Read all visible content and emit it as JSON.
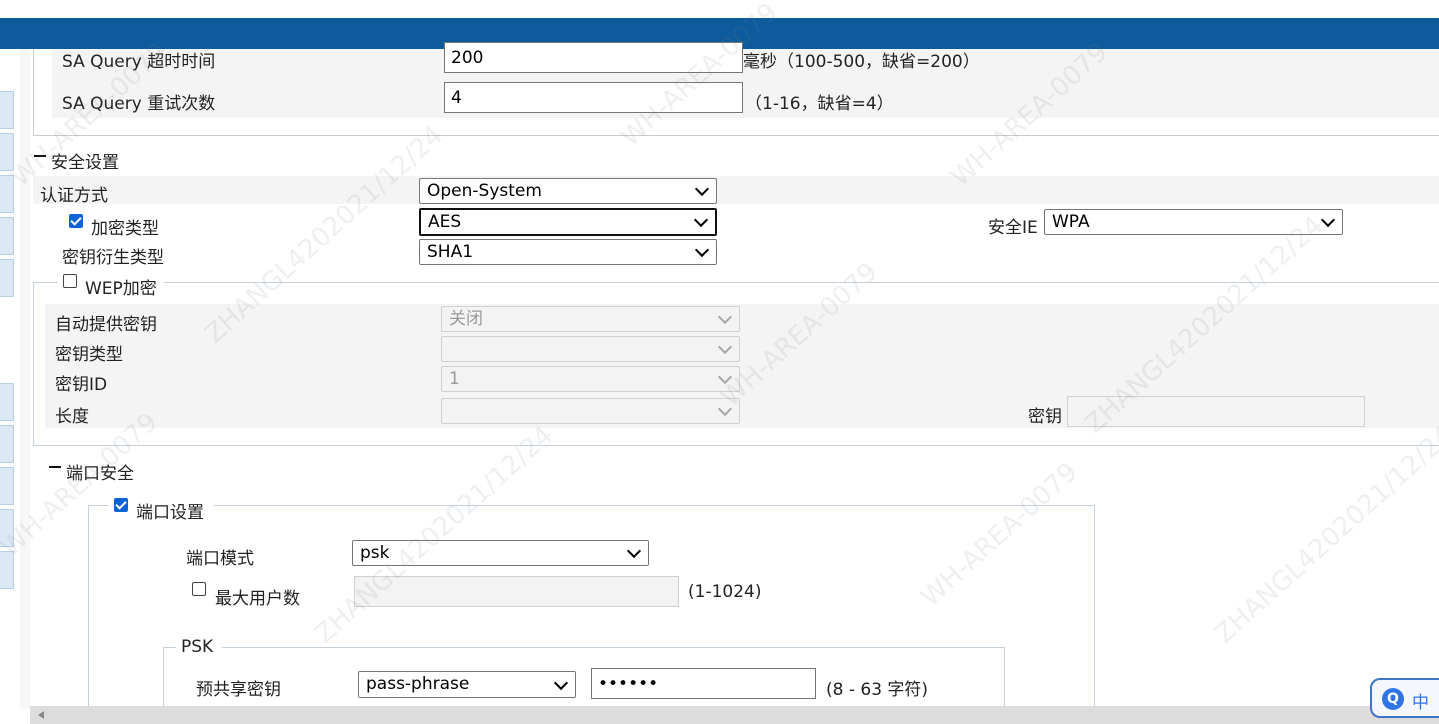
{
  "sa_query": {
    "timeout_label": "SA Query 超时时间",
    "timeout_value": "200",
    "timeout_hint": "毫秒（100-500，缺省=200）",
    "retry_label": "SA Query 重试次数",
    "retry_value": "4",
    "retry_hint": "（1-16，缺省=4）"
  },
  "security": {
    "section_title": "安全设置",
    "auth_label": "认证方式",
    "auth_value": "Open-System",
    "encrypt_label": "加密类型",
    "encrypt_checked": true,
    "encrypt_value": "AES",
    "security_ie_label": "安全IE",
    "security_ie_value": "WPA",
    "key_derivation_label": "密钥衍生类型",
    "key_derivation_value": "SHA1"
  },
  "wep": {
    "legend": "WEP加密",
    "checked": false,
    "auto_key_label": "自动提供密钥",
    "auto_key_value": "关闭",
    "key_type_label": "密钥类型",
    "key_type_value": "",
    "key_id_label": "密钥ID",
    "key_id_value": "1",
    "length_label": "长度",
    "length_value": "",
    "key_label": "密钥",
    "key_value": ""
  },
  "port_security": {
    "section_title": "端口安全",
    "port_settings_legend": "端口设置",
    "port_settings_checked": true,
    "port_mode_label": "端口模式",
    "port_mode_value": "psk",
    "max_users_label": "最大用户数",
    "max_users_checked": false,
    "max_users_value": "",
    "max_users_hint": "(1-1024)",
    "psk_legend": "PSK",
    "psk_label": "预共享密钥",
    "psk_type_value": "pass-phrase",
    "psk_value": "••••••",
    "psk_hint": "(8 - 63 字符)"
  },
  "ime": {
    "icon": "Q",
    "label": "中"
  },
  "watermark": {
    "lines": [
      "WH-AREA-0079",
      "ZHANGL4202021/12/24"
    ]
  },
  "colors": {
    "header": "#0d5a9c",
    "checkbox": "#0b63d6"
  }
}
